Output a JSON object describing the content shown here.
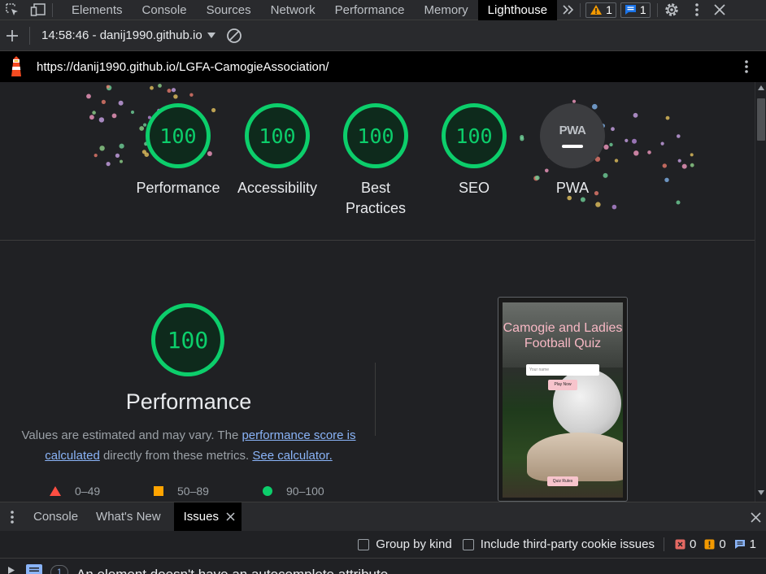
{
  "devtools": {
    "tabs": [
      "Elements",
      "Console",
      "Sources",
      "Network",
      "Performance",
      "Memory",
      "Lighthouse"
    ],
    "active_tab": "Lighthouse",
    "warning_count": "1",
    "message_count": "1"
  },
  "report_bar": {
    "timestamp_host": "14:58:46 - danij1990.github.io"
  },
  "url_bar": {
    "url": "https://danij1990.github.io/LGFA-CamogieAssociation/"
  },
  "summary": {
    "gauges": [
      {
        "score": "100",
        "label": "Performance"
      },
      {
        "score": "100",
        "label": "Accessibility"
      },
      {
        "score": "100",
        "label": "Best Practices"
      },
      {
        "score": "100",
        "label": "SEO"
      }
    ],
    "pwa": {
      "badge": "PWA",
      "label": "PWA"
    }
  },
  "performance": {
    "score": "100",
    "title": "Performance",
    "desc_prefix": "Values are estimated and may vary. The ",
    "desc_link1": "performance score is calculated",
    "desc_middle": " directly from these metrics. ",
    "desc_link2": "See calculator.",
    "legend": [
      {
        "range": "0–49",
        "color": "#ff4e42"
      },
      {
        "range": "50–89",
        "color": "#ffa400"
      },
      {
        "range": "90–100",
        "color": "#0cce6b"
      }
    ]
  },
  "screenshot": {
    "title_line1": "Camogie and Ladies",
    "title_line2": "Football Quiz",
    "input_placeholder": "Your name",
    "play_button": "Play Now",
    "rules_button": "Quiz Rules"
  },
  "drawer": {
    "tabs": [
      "Console",
      "What's New",
      "Issues"
    ],
    "active_tab": "Issues",
    "group_by_kind": "Group by kind",
    "third_party": "Include third-party cookie issues",
    "error_count": "0",
    "warning_count": "0",
    "info_count": "1"
  },
  "issue": {
    "count": "1",
    "text": "An element doesn't have an autocomplete attribute"
  },
  "colors": {
    "pass": "#0cce6b",
    "link": "#8ab4f8",
    "background": "#202124"
  }
}
